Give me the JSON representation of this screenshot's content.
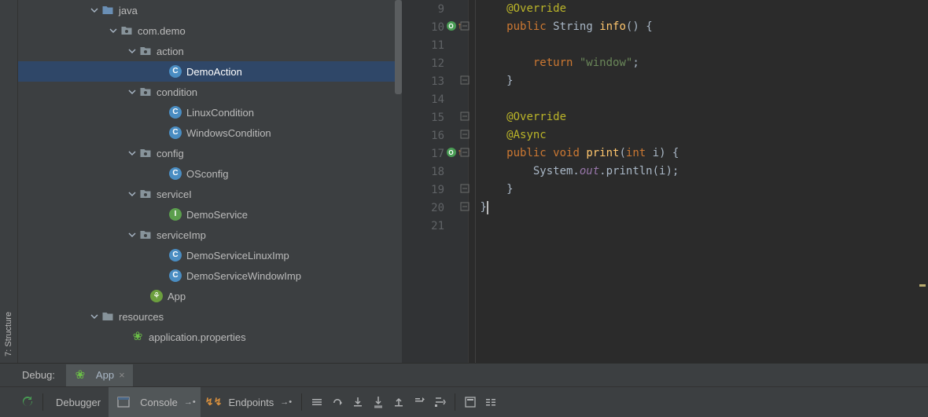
{
  "sidebar": {
    "structure_tab": "7: Structure"
  },
  "tree": {
    "rows": [
      {
        "indent": 90,
        "chevron": "down",
        "icon": "folder-src",
        "label": "java"
      },
      {
        "indent": 114,
        "chevron": "down",
        "icon": "pkg",
        "label": "com.demo"
      },
      {
        "indent": 138,
        "chevron": "down",
        "icon": "pkg",
        "label": "action"
      },
      {
        "indent": 176,
        "chevron": "none",
        "icon": "class",
        "label": "DemoAction",
        "selected": true
      },
      {
        "indent": 138,
        "chevron": "down",
        "icon": "pkg",
        "label": "condition"
      },
      {
        "indent": 176,
        "chevron": "none",
        "icon": "class",
        "label": "LinuxCondition"
      },
      {
        "indent": 176,
        "chevron": "none",
        "icon": "class",
        "label": "WindowsCondition"
      },
      {
        "indent": 138,
        "chevron": "down",
        "icon": "pkg",
        "label": "config"
      },
      {
        "indent": 176,
        "chevron": "none",
        "icon": "class",
        "label": "OSconfig"
      },
      {
        "indent": 138,
        "chevron": "down",
        "icon": "pkg",
        "label": "serviceI"
      },
      {
        "indent": 176,
        "chevron": "none",
        "icon": "iface",
        "label": "DemoService"
      },
      {
        "indent": 138,
        "chevron": "down",
        "icon": "pkg",
        "label": "serviceImp"
      },
      {
        "indent": 176,
        "chevron": "none",
        "icon": "class",
        "label": "DemoServiceLinuxImp"
      },
      {
        "indent": 176,
        "chevron": "none",
        "icon": "class",
        "label": "DemoServiceWindowImp"
      },
      {
        "indent": 152,
        "chevron": "none",
        "icon": "spring",
        "label": "App"
      },
      {
        "indent": 90,
        "chevron": "down",
        "icon": "res",
        "label": "resources"
      },
      {
        "indent": 128,
        "chevron": "none",
        "icon": "spring2",
        "label": "application.properties"
      }
    ]
  },
  "editor": {
    "lines": [
      {
        "num": "9",
        "mark": "",
        "fold": "",
        "tokens": [
          {
            "sp": 40
          },
          {
            "t": "@Override",
            "c": "annot"
          }
        ]
      },
      {
        "num": "10",
        "mark": "override",
        "fold": "minus",
        "tokens": [
          {
            "sp": 40
          },
          {
            "t": "public ",
            "c": "kw"
          },
          {
            "t": "String ",
            "c": "type"
          },
          {
            "t": "info",
            "c": "method"
          },
          {
            "t": "() {",
            "c": "paren"
          }
        ]
      },
      {
        "num": "11",
        "mark": "",
        "fold": "",
        "tokens": []
      },
      {
        "num": "12",
        "mark": "",
        "fold": "",
        "tokens": [
          {
            "sp": 70
          },
          {
            "t": "return ",
            "c": "kw"
          },
          {
            "t": "\"window\"",
            "c": "str"
          },
          {
            "t": ";",
            "c": "plain"
          }
        ]
      },
      {
        "num": "13",
        "mark": "",
        "fold": "up",
        "tokens": [
          {
            "sp": 40
          },
          {
            "t": "}",
            "c": "plain"
          }
        ]
      },
      {
        "num": "14",
        "mark": "",
        "fold": "",
        "tokens": []
      },
      {
        "num": "15",
        "mark": "",
        "fold": "minus",
        "tokens": [
          {
            "sp": 40
          },
          {
            "t": "@Override",
            "c": "annot"
          }
        ]
      },
      {
        "num": "16",
        "mark": "",
        "fold": "up",
        "tokens": [
          {
            "sp": 40
          },
          {
            "t": "@Async",
            "c": "annot"
          }
        ]
      },
      {
        "num": "17",
        "mark": "override",
        "fold": "minus",
        "tokens": [
          {
            "sp": 40
          },
          {
            "t": "public ",
            "c": "kw"
          },
          {
            "t": "void ",
            "c": "kw"
          },
          {
            "t": "print",
            "c": "method"
          },
          {
            "t": "(",
            "c": "paren"
          },
          {
            "t": "int ",
            "c": "kw"
          },
          {
            "t": "i",
            "c": "plain"
          },
          {
            "t": ") {",
            "c": "paren"
          }
        ]
      },
      {
        "num": "18",
        "mark": "",
        "fold": "",
        "tokens": [
          {
            "sp": 70
          },
          {
            "t": "System.",
            "c": "plain"
          },
          {
            "t": "out",
            "c": "static"
          },
          {
            "t": ".println(i);",
            "c": "plain"
          }
        ]
      },
      {
        "num": "19",
        "mark": "",
        "fold": "up",
        "tokens": [
          {
            "sp": 40
          },
          {
            "t": "}",
            "c": "plain"
          }
        ]
      },
      {
        "num": "20",
        "mark": "",
        "fold": "up",
        "tokens": [
          {
            "sp": 10
          },
          {
            "t": "}",
            "c": "plain",
            "caret": true
          }
        ]
      },
      {
        "num": "21",
        "mark": "",
        "fold": "",
        "tokens": []
      }
    ]
  },
  "debug": {
    "title": "Debug:",
    "tab_label": "App",
    "debugger_label": "Debugger",
    "console_label": "Console",
    "endpoints_label": "Endpoints"
  }
}
